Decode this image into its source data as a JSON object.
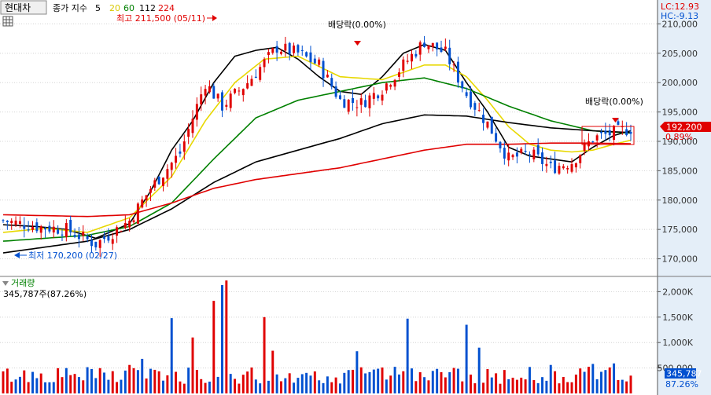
{
  "header": {
    "title": "현대차",
    "ma_label": "종가 지수",
    "ma_periods": [
      "5",
      "20",
      "60",
      "112",
      "224"
    ],
    "ma_colors": [
      "#000000",
      "#e8d800",
      "#008000",
      "#000000",
      "#e00000"
    ],
    "high_note": "최고 211,500 (05/11)",
    "low_note": "최저 170,200 (02/27)",
    "lc": "LC:12.93",
    "hc": "HC:-9.13",
    "div_note_1": "배당락(0.00%)",
    "div_note_2": "배당락(0.00%)",
    "current_price": "192,200",
    "current_change": "0.89%"
  },
  "volume_header": {
    "title": "거래량",
    "value": "345,787주(87.26%)",
    "current_volume": "345,787",
    "current_pct": "87.26%"
  },
  "colors": {
    "up": "#e00000",
    "down": "#0050d0",
    "axis_bg": "#e4eef8",
    "grid": "#c8c8c8"
  },
  "chart_data": [
    {
      "type": "line",
      "title": "",
      "price_axis": {
        "ylim": [
          167000,
          213000
        ],
        "ticks": [
          170000,
          175000,
          180000,
          185000,
          190000,
          195000,
          200000,
          205000,
          210000
        ],
        "tick_labels": [
          "170,000",
          "175,000",
          "180,000",
          "185,000",
          "190,000",
          "195,000",
          "200,000",
          "205,000",
          "210,000"
        ]
      },
      "bars": 150,
      "close_path": [
        [
          0,
          176500
        ],
        [
          8,
          175500
        ],
        [
          15,
          175000
        ],
        [
          22,
          172500
        ],
        [
          30,
          176500
        ],
        [
          35,
          182000
        ],
        [
          42,
          188000
        ],
        [
          48,
          200000
        ],
        [
          52,
          196000
        ],
        [
          58,
          200000
        ],
        [
          65,
          206000
        ],
        [
          70,
          205000
        ],
        [
          75,
          203000
        ],
        [
          80,
          197000
        ],
        [
          85,
          196500
        ],
        [
          90,
          199000
        ],
        [
          95,
          203000
        ],
        [
          100,
          207000
        ],
        [
          105,
          205000
        ],
        [
          110,
          198000
        ],
        [
          115,
          193000
        ],
        [
          120,
          187000
        ],
        [
          125,
          188000
        ],
        [
          130,
          185500
        ],
        [
          135,
          186500
        ],
        [
          140,
          190500
        ],
        [
          145,
          191500
        ],
        [
          149,
          192200
        ]
      ],
      "series": [
        {
          "name": "5",
          "color": "#000000",
          "points": [
            [
              0,
              175800
            ],
            [
              8,
              175500
            ],
            [
              15,
              175000
            ],
            [
              22,
              173500
            ],
            [
              30,
              176000
            ],
            [
              35,
              181500
            ],
            [
              40,
              188500
            ],
            [
              45,
              193500
            ],
            [
              50,
              200000
            ],
            [
              55,
              204500
            ],
            [
              60,
              205500
            ],
            [
              65,
              206000
            ],
            [
              70,
              204000
            ],
            [
              75,
              201000
            ],
            [
              80,
              198500
            ],
            [
              85,
              198000
            ],
            [
              90,
              201000
            ],
            [
              95,
              205000
            ],
            [
              100,
              206500
            ],
            [
              105,
              205500
            ],
            [
              110,
              200000
            ],
            [
              115,
              195000
            ],
            [
              120,
              189000
            ],
            [
              125,
              187500
            ],
            [
              130,
              187000
            ],
            [
              135,
              186500
            ],
            [
              140,
              189000
            ],
            [
              145,
              191000
            ],
            [
              149,
              191800
            ]
          ]
        },
        {
          "name": "20",
          "color": "#e8d800",
          "points": [
            [
              0,
              174500
            ],
            [
              10,
              175200
            ],
            [
              20,
              174500
            ],
            [
              30,
              177000
            ],
            [
              40,
              184000
            ],
            [
              48,
              193500
            ],
            [
              55,
              200000
            ],
            [
              62,
              204000
            ],
            [
              70,
              204500
            ],
            [
              80,
              201000
            ],
            [
              90,
              200500
            ],
            [
              100,
              203000
            ],
            [
              105,
              203000
            ],
            [
              110,
              201000
            ],
            [
              115,
              197000
            ],
            [
              120,
              192500
            ],
            [
              125,
              189500
            ],
            [
              130,
              188500
            ],
            [
              135,
              188200
            ],
            [
              140,
              188500
            ],
            [
              145,
              189500
            ],
            [
              149,
              190200
            ]
          ]
        },
        {
          "name": "60",
          "color": "#008000",
          "points": [
            [
              0,
              173000
            ],
            [
              20,
              174000
            ],
            [
              30,
              175500
            ],
            [
              40,
              179500
            ],
            [
              50,
              187000
            ],
            [
              60,
              194000
            ],
            [
              70,
              197000
            ],
            [
              80,
              198500
            ],
            [
              90,
              200000
            ],
            [
              100,
              200800
            ],
            [
              110,
              199000
            ],
            [
              120,
              196000
            ],
            [
              130,
              193500
            ],
            [
              140,
              191800
            ],
            [
              149,
              191400
            ]
          ]
        },
        {
          "name": "112",
          "color": "#000000",
          "points": [
            [
              0,
              171000
            ],
            [
              20,
              173000
            ],
            [
              30,
              175000
            ],
            [
              40,
              178500
            ],
            [
              50,
              183000
            ],
            [
              60,
              186500
            ],
            [
              70,
              188500
            ],
            [
              80,
              190500
            ],
            [
              90,
              193000
            ],
            [
              100,
              194500
            ],
            [
              110,
              194300
            ],
            [
              120,
              193200
            ],
            [
              130,
              192300
            ],
            [
              140,
              191800
            ],
            [
              149,
              191500
            ]
          ]
        },
        {
          "name": "224",
          "color": "#e00000",
          "points": [
            [
              0,
              177500
            ],
            [
              20,
              177200
            ],
            [
              30,
              177500
            ],
            [
              40,
              179500
            ],
            [
              50,
              182000
            ],
            [
              60,
              183500
            ],
            [
              70,
              184500
            ],
            [
              80,
              185500
            ],
            [
              90,
              187000
            ],
            [
              100,
              188500
            ],
            [
              110,
              189500
            ],
            [
              120,
              189500
            ],
            [
              130,
              189700
            ],
            [
              140,
              189700
            ],
            [
              149,
              189600
            ]
          ]
        }
      ]
    },
    {
      "type": "bar",
      "title": "거래량",
      "ylim": [
        0,
        2300000
      ],
      "ticks": [
        500000,
        1000000,
        1500000,
        2000000
      ],
      "tick_labels": [
        "500,000",
        "1,000K",
        "1,500K",
        "2,000K"
      ],
      "spikes": [
        [
          30,
          560000
        ],
        [
          33,
          680000
        ],
        [
          40,
          1480000
        ],
        [
          45,
          1100000
        ],
        [
          50,
          1820000
        ],
        [
          52,
          2130000
        ],
        [
          53,
          2220000
        ],
        [
          62,
          1500000
        ],
        [
          64,
          840000
        ],
        [
          84,
          830000
        ],
        [
          96,
          1470000
        ],
        [
          110,
          1350000
        ],
        [
          113,
          900000
        ],
        [
          130,
          560000
        ],
        [
          140,
          580000
        ],
        [
          145,
          590000
        ],
        [
          149,
          350000
        ]
      ],
      "base_level": 420000
    }
  ]
}
